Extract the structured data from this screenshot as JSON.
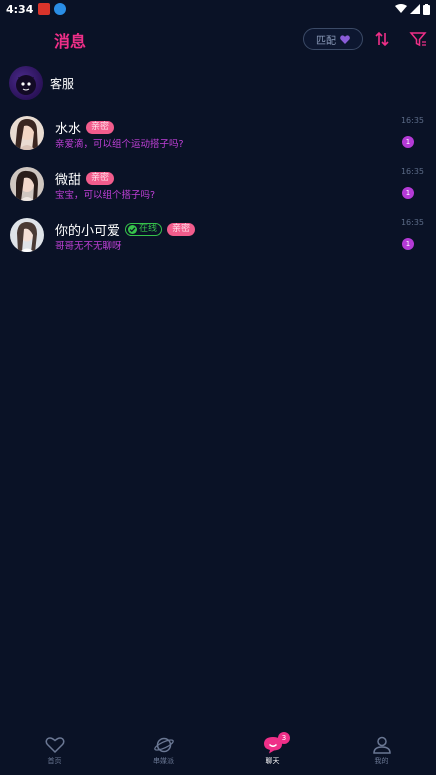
{
  "status_bar": {
    "time": "4:34"
  },
  "header": {
    "title": "消息",
    "match_label": "匹配"
  },
  "customer_service": {
    "label": "客服"
  },
  "conversations": [
    {
      "name": "水水",
      "tag": "亲密",
      "online": false,
      "preview": "亲爱滴，可以组个运动搭子吗?",
      "time": "16:35",
      "unread": "1"
    },
    {
      "name": "微甜",
      "tag": "亲密",
      "online": false,
      "preview": "宝宝，可以组个搭子吗?",
      "time": "16:35",
      "unread": "1"
    },
    {
      "name": "你的小可爱",
      "online_label": "在线",
      "tag": "亲密",
      "online": true,
      "preview": "哥哥无不无聊呀",
      "time": "16:35",
      "unread": "1"
    }
  ],
  "tabbar": {
    "items": [
      {
        "label": "首页",
        "icon": "heart-icon"
      },
      {
        "label": "串媒派",
        "icon": "planet-icon"
      },
      {
        "label": "聊天",
        "icon": "chat-icon",
        "badge": "3",
        "active": true
      },
      {
        "label": "我的",
        "icon": "user-icon"
      }
    ]
  },
  "colors": {
    "background": "#0a1226",
    "accent": "#ef2f88",
    "preview": "#c040d8",
    "online": "#37c24b",
    "tag": "#f25c8c"
  }
}
